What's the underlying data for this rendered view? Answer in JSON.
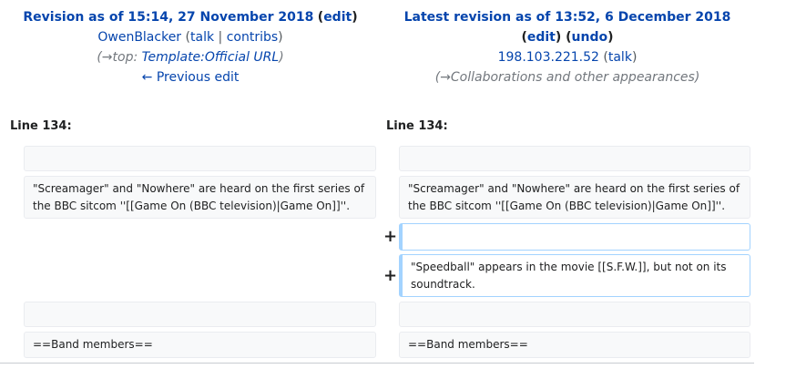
{
  "left_header": {
    "title": "Revision as of 15:14, 27 November 2018",
    "edit": "edit",
    "user": "OwenBlacker",
    "talk": "talk",
    "contribs": "contribs",
    "comment_prefix": "(→top: ",
    "comment_link": "Template:Official URL",
    "comment_suffix": ")",
    "prev_edit": "← Previous edit"
  },
  "right_header": {
    "title": "Latest revision as of 13:52, 6 December 2018",
    "edit": "edit",
    "undo": "undo",
    "user": "198.103.221.52",
    "talk": "talk",
    "comment": "(→Collaborations and other appearances)"
  },
  "line_label_left": "Line 134:",
  "line_label_right": "Line 134:",
  "diff": {
    "context_text": "\"Screamager\" and \"Nowhere\" are heard on the first series of the BBC sitcom ''[[Game On (BBC television)|Game On]]''.",
    "added_line": "\"Speedball\" appears in the movie [[S.F.W.]], but not on its soundtrack.",
    "band_members": "==Band members==",
    "plus": "+"
  }
}
